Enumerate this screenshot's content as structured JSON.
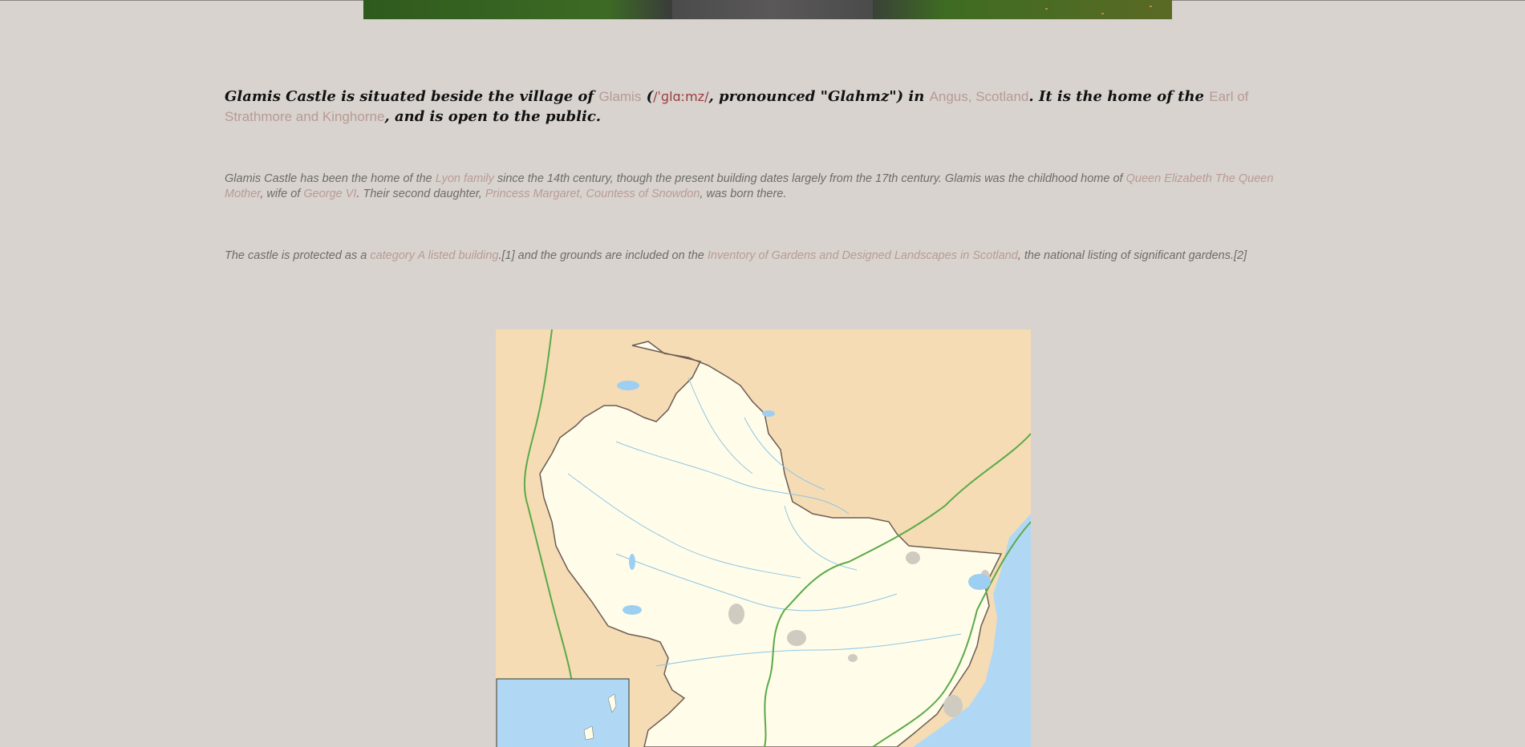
{
  "hero": {
    "alt": "Glamis Castle photograph"
  },
  "intro": {
    "t1": "Glamis Castle is situated beside the village of ",
    "l1": "Glamis",
    "t2": " (",
    "ipa": "/ˈɡlɑːmz/",
    "t3": ", pronounced \"Glahmz\") in ",
    "l2": "Angus, Scotland",
    "t4": ". It is the home of the ",
    "l3": "Earl of Strathmore and Kinghorne",
    "t5": ", and is open to the public."
  },
  "history": {
    "t1": "Glamis Castle has been the home of the ",
    "l1": "Lyon family",
    "t2": " since the 14th century, though the present building dates largely from the 17th century. Glamis was the childhood home of ",
    "l2": "Queen Elizabeth The Queen Mother",
    "t3": ", wife of ",
    "l3": "George VI",
    "t4": ". Their second daughter, ",
    "l4": "Princess Margaret, Countess of Snowdon",
    "t5": ", was born there."
  },
  "protection": {
    "t1": "The castle is protected as a ",
    "l1": "category A listed building",
    "t2": ".[1] and the grounds are included on the ",
    "l2": "Inventory of Gardens and Designed Landscapes in Scotland",
    "t3": ", the national listing of significant gardens.[2]"
  },
  "colors": {
    "background": "#d8d3ce",
    "link": "#b89a96",
    "ipa": "#9c3b40",
    "map_land": "#fffde9",
    "map_outside": "#f5dcb4",
    "map_water": "#b0d8f5",
    "map_road": "#5aaa4a"
  }
}
